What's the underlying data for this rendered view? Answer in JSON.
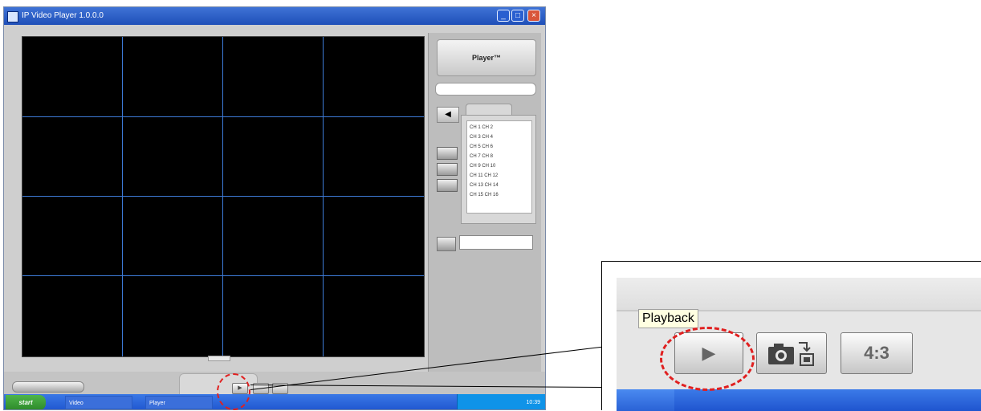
{
  "app": {
    "title": "IP Video Player 1.0.0.0",
    "player_label": "Player™",
    "channel_tab_label": "",
    "channels": [
      "CH 1  CH 2",
      "CH 3  CH 4",
      "CH 5  CH 6",
      "CH 7  CH 8",
      "CH 9  CH 10",
      "CH 11 CH 12",
      "CH 13 CH 14",
      "CH 15 CH 16"
    ],
    "grid": {
      "rows": 4,
      "cols": 4
    }
  },
  "taskbar": {
    "start_label": "start",
    "items": [
      "Video",
      "Player"
    ],
    "clock": "10:39"
  },
  "zoom": {
    "tooltip": "Playback",
    "play_glyph": "▶",
    "ratio_label": "4:3"
  },
  "colors": {
    "highlight": "#e02020",
    "grid_line": "#3d7bd8",
    "taskbar": "#1f55cf"
  }
}
